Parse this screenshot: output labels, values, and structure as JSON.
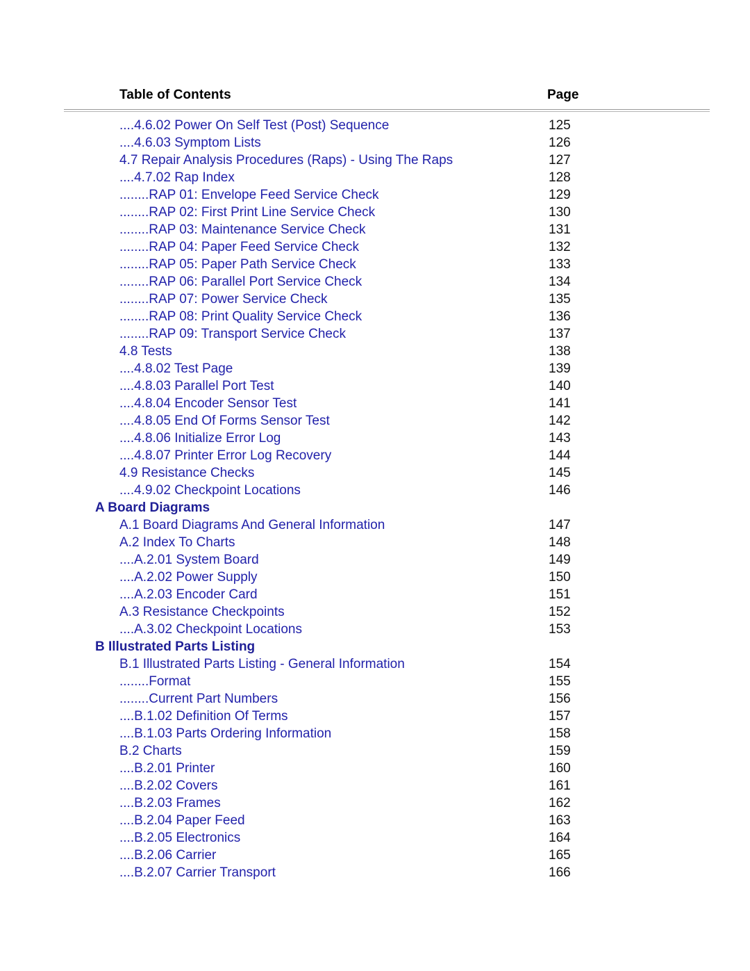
{
  "header": {
    "title": "Table of Contents",
    "page_column": "Page"
  },
  "theme": {
    "entry_color": "#2222AA",
    "heading_color": "#1F1F96",
    "page_number_color": "#111111",
    "header_color": "#000000",
    "rule_color": "#9A9A9A",
    "background": "#FFFFFF"
  },
  "entries": [
    {
      "label": "....4.6.02 Power On Self Test (Post) Sequence",
      "page": "125",
      "heading": false
    },
    {
      "label": "....4.6.03 Symptom Lists",
      "page": "126",
      "heading": false
    },
    {
      "label": "4.7 Repair Analysis Procedures (Raps) - Using The Raps",
      "page": "127",
      "heading": false
    },
    {
      "label": "....4.7.02 Rap Index",
      "page": "128",
      "heading": false
    },
    {
      "label": "........RAP 01: Envelope Feed Service Check",
      "page": "129",
      "heading": false
    },
    {
      "label": "........RAP 02: First Print Line Service Check",
      "page": "130",
      "heading": false
    },
    {
      "label": "........RAP 03: Maintenance Service Check",
      "page": "131",
      "heading": false
    },
    {
      "label": "........RAP 04: Paper Feed Service Check",
      "page": "132",
      "heading": false
    },
    {
      "label": "........RAP 05: Paper Path Service Check",
      "page": "133",
      "heading": false
    },
    {
      "label": "........RAP 06: Parallel Port Service Check",
      "page": "134",
      "heading": false
    },
    {
      "label": "........RAP 07: Power Service Check",
      "page": "135",
      "heading": false
    },
    {
      "label": "........RAP 08: Print Quality Service Check",
      "page": "136",
      "heading": false
    },
    {
      "label": "........RAP 09: Transport Service Check",
      "page": "137",
      "heading": false
    },
    {
      "label": "4.8 Tests",
      "page": "138",
      "heading": false
    },
    {
      "label": "....4.8.02 Test Page",
      "page": "139",
      "heading": false
    },
    {
      "label": "....4.8.03 Parallel Port Test",
      "page": "140",
      "heading": false
    },
    {
      "label": "....4.8.04 Encoder Sensor Test",
      "page": "141",
      "heading": false
    },
    {
      "label": "....4.8.05 End Of Forms Sensor Test",
      "page": "142",
      "heading": false
    },
    {
      "label": "....4.8.06 Initialize Error Log",
      "page": "143",
      "heading": false
    },
    {
      "label": "....4.8.07 Printer Error Log Recovery",
      "page": "144",
      "heading": false
    },
    {
      "label": "4.9 Resistance Checks",
      "page": "145",
      "heading": false
    },
    {
      "label": "....4.9.02 Checkpoint Locations",
      "page": "146",
      "heading": false
    },
    {
      "label": "A Board Diagrams",
      "page": "",
      "heading": true
    },
    {
      "label": "A.1 Board Diagrams And General Information",
      "page": "147",
      "heading": false
    },
    {
      "label": "A.2 Index To Charts",
      "page": "148",
      "heading": false
    },
    {
      "label": "....A.2.01 System Board",
      "page": "149",
      "heading": false
    },
    {
      "label": "....A.2.02 Power Supply",
      "page": "150",
      "heading": false
    },
    {
      "label": "....A.2.03 Encoder Card",
      "page": "151",
      "heading": false
    },
    {
      "label": "A.3 Resistance Checkpoints",
      "page": "152",
      "heading": false
    },
    {
      "label": "....A.3.02 Checkpoint Locations",
      "page": "153",
      "heading": false
    },
    {
      "label": "B Illustrated Parts Listing",
      "page": "",
      "heading": true
    },
    {
      "label": "B.1 Illustrated Parts Listing - General Information",
      "page": "154",
      "heading": false
    },
    {
      "label": "........Format",
      "page": "155",
      "heading": false
    },
    {
      "label": "........Current Part Numbers",
      "page": "156",
      "heading": false
    },
    {
      "label": "....B.1.02 Definition Of Terms",
      "page": "157",
      "heading": false
    },
    {
      "label": "....B.1.03 Parts Ordering Information",
      "page": "158",
      "heading": false
    },
    {
      "label": "B.2 Charts",
      "page": "159",
      "heading": false
    },
    {
      "label": "....B.2.01 Printer",
      "page": "160",
      "heading": false
    },
    {
      "label": "....B.2.02 Covers",
      "page": "161",
      "heading": false
    },
    {
      "label": "....B.2.03 Frames",
      "page": "162",
      "heading": false
    },
    {
      "label": "....B.2.04 Paper Feed",
      "page": "163",
      "heading": false
    },
    {
      "label": "....B.2.05 Electronics",
      "page": "164",
      "heading": false
    },
    {
      "label": "....B.2.06 Carrier",
      "page": "165",
      "heading": false
    },
    {
      "label": "....B.2.07 Carrier Transport",
      "page": "166",
      "heading": false
    }
  ]
}
